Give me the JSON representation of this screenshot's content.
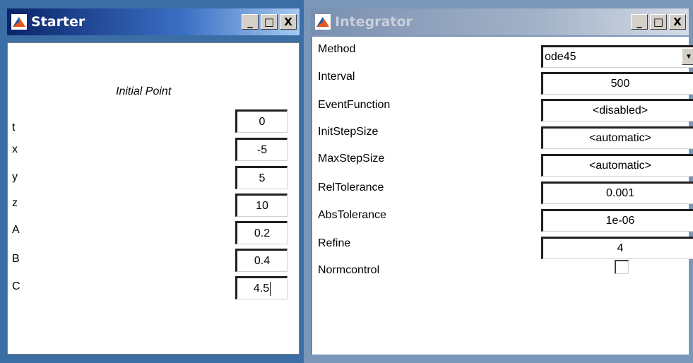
{
  "starter": {
    "title": "Starter",
    "heading": "Initial Point",
    "fields": [
      {
        "label": "t",
        "value": "0"
      },
      {
        "label": "x",
        "value": "-5"
      },
      {
        "label": "y",
        "value": "5"
      },
      {
        "label": "z",
        "value": "10"
      },
      {
        "label": "A",
        "value": "0.2"
      },
      {
        "label": "B",
        "value": "0.4"
      },
      {
        "label": "C",
        "value": "4.5"
      }
    ]
  },
  "integrator": {
    "title": "Integrator",
    "method": {
      "label": "Method",
      "value": "ode45"
    },
    "fields": [
      {
        "label": "Interval",
        "value": "500"
      },
      {
        "label": "EventFunction",
        "value": "<disabled>"
      },
      {
        "label": "InitStepSize",
        "value": "<automatic>"
      },
      {
        "label": "MaxStepSize",
        "value": "<automatic>"
      },
      {
        "label": "RelTolerance",
        "value": "0.001"
      },
      {
        "label": "AbsTolerance",
        "value": "1e-06"
      },
      {
        "label": "Refine",
        "value": "4"
      }
    ],
    "normcontrol": {
      "label": "Normcontrol",
      "checked": false
    }
  },
  "window_buttons": {
    "minimize": "_",
    "maximize": "□",
    "close": "X"
  },
  "icons": {
    "app": "matlab-logo-icon"
  },
  "colors": {
    "active_title": "#0a246a",
    "inactive_title": "#7a8fb0",
    "chrome": "#d4d0c8",
    "logo_orange": "#e8571e",
    "logo_blue": "#1e56a0"
  }
}
